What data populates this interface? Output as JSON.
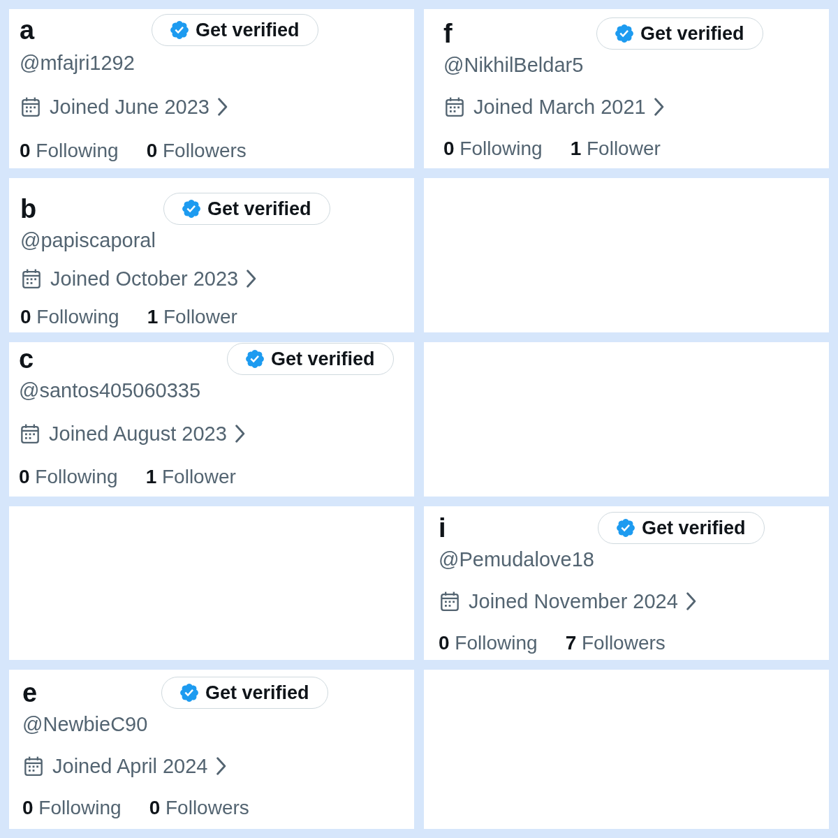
{
  "panels": [
    {
      "kind": "profile",
      "letter": "a",
      "verify_button": "Get verified",
      "handle": "@mfajri1292",
      "joined": "Joined June 2023",
      "stats": [
        {
          "count": "0",
          "label": "Following"
        },
        {
          "count": "0",
          "label": "Followers"
        }
      ]
    },
    {
      "kind": "profile",
      "letter": "f",
      "verify_button": "Get verified",
      "handle": "@NikhilBeldar5",
      "joined": "Joined March 2021",
      "stats": [
        {
          "count": "0",
          "label": "Following"
        },
        {
          "count": "1",
          "label": "Follower"
        }
      ]
    },
    {
      "kind": "profile",
      "letter": "b",
      "verify_button": "Get verified",
      "handle": "@papiscaporal",
      "joined": "Joined October 2023",
      "stats": [
        {
          "count": "0",
          "label": "Following"
        },
        {
          "count": "1",
          "label": "Follower"
        }
      ]
    },
    {
      "kind": "empty"
    },
    {
      "kind": "profile",
      "letter": "c",
      "verify_button": "Get verified",
      "handle": "@santos405060335",
      "joined": "Joined August 2023",
      "stats": [
        {
          "count": "0",
          "label": "Following"
        },
        {
          "count": "1",
          "label": "Follower"
        }
      ]
    },
    {
      "kind": "empty"
    },
    {
      "kind": "empty"
    },
    {
      "kind": "profile",
      "letter": "i",
      "verify_button": "Get verified",
      "handle": "@Pemudalove18",
      "joined": "Joined November 2024",
      "stats": [
        {
          "count": "0",
          "label": "Following"
        },
        {
          "count": "7",
          "label": "Followers"
        }
      ]
    },
    {
      "kind": "profile",
      "letter": "e",
      "verify_button": "Get verified",
      "handle": "@NewbieC90",
      "joined": "Joined April 2024",
      "stats": [
        {
          "count": "0",
          "label": "Following"
        },
        {
          "count": "0",
          "label": "Followers"
        }
      ]
    },
    {
      "kind": "empty"
    }
  ]
}
